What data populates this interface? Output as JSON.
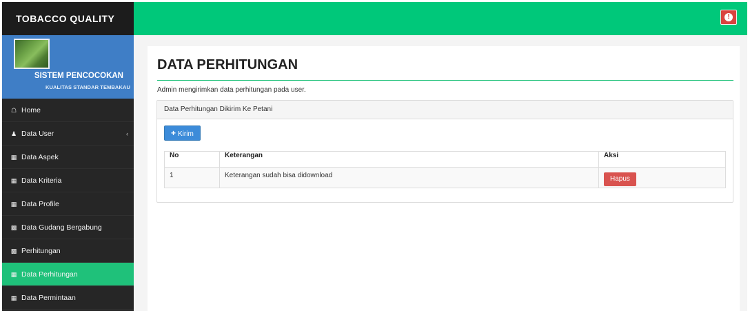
{
  "sidebar": {
    "brand": "TOBACCO QUALITY",
    "profile": {
      "title": "SISTEM PENCOCOKAN",
      "subtitle": "KUALITAS STANDAR TEMBAKAU"
    },
    "items": [
      {
        "label": "Home",
        "icon": "home-icon"
      },
      {
        "label": "Data User",
        "icon": "user-icon",
        "has_submenu": true
      },
      {
        "label": "Data Aspek",
        "icon": "table-icon"
      },
      {
        "label": "Data Kriteria",
        "icon": "table-icon"
      },
      {
        "label": "Data Profile",
        "icon": "table-icon"
      },
      {
        "label": "Data Gudang Bergabung",
        "icon": "calculator-icon"
      },
      {
        "label": "Perhitungan",
        "icon": "calculator-icon"
      },
      {
        "label": "Data Perhitungan",
        "icon": "table-icon",
        "active": true
      },
      {
        "label": "Data Permintaan",
        "icon": "table-icon"
      }
    ]
  },
  "topbar": {
    "alert_icon": "exclamation-icon",
    "accent_color": "#00c87a",
    "alert_color": "#d9433f"
  },
  "main": {
    "title": "DATA PERHITUNGAN",
    "subtitle": "Admin mengirimkan data perhitungan pada user.",
    "panel": {
      "heading": "Data Perhitungan Dikirim Ke Petani",
      "send_button": "Kirim",
      "table": {
        "headers": [
          "No",
          "Keterangan",
          "Aksi"
        ],
        "rows": [
          {
            "no": "1",
            "keterangan": "Keterangan sudah bisa didownload",
            "action": "Hapus"
          }
        ]
      }
    }
  }
}
